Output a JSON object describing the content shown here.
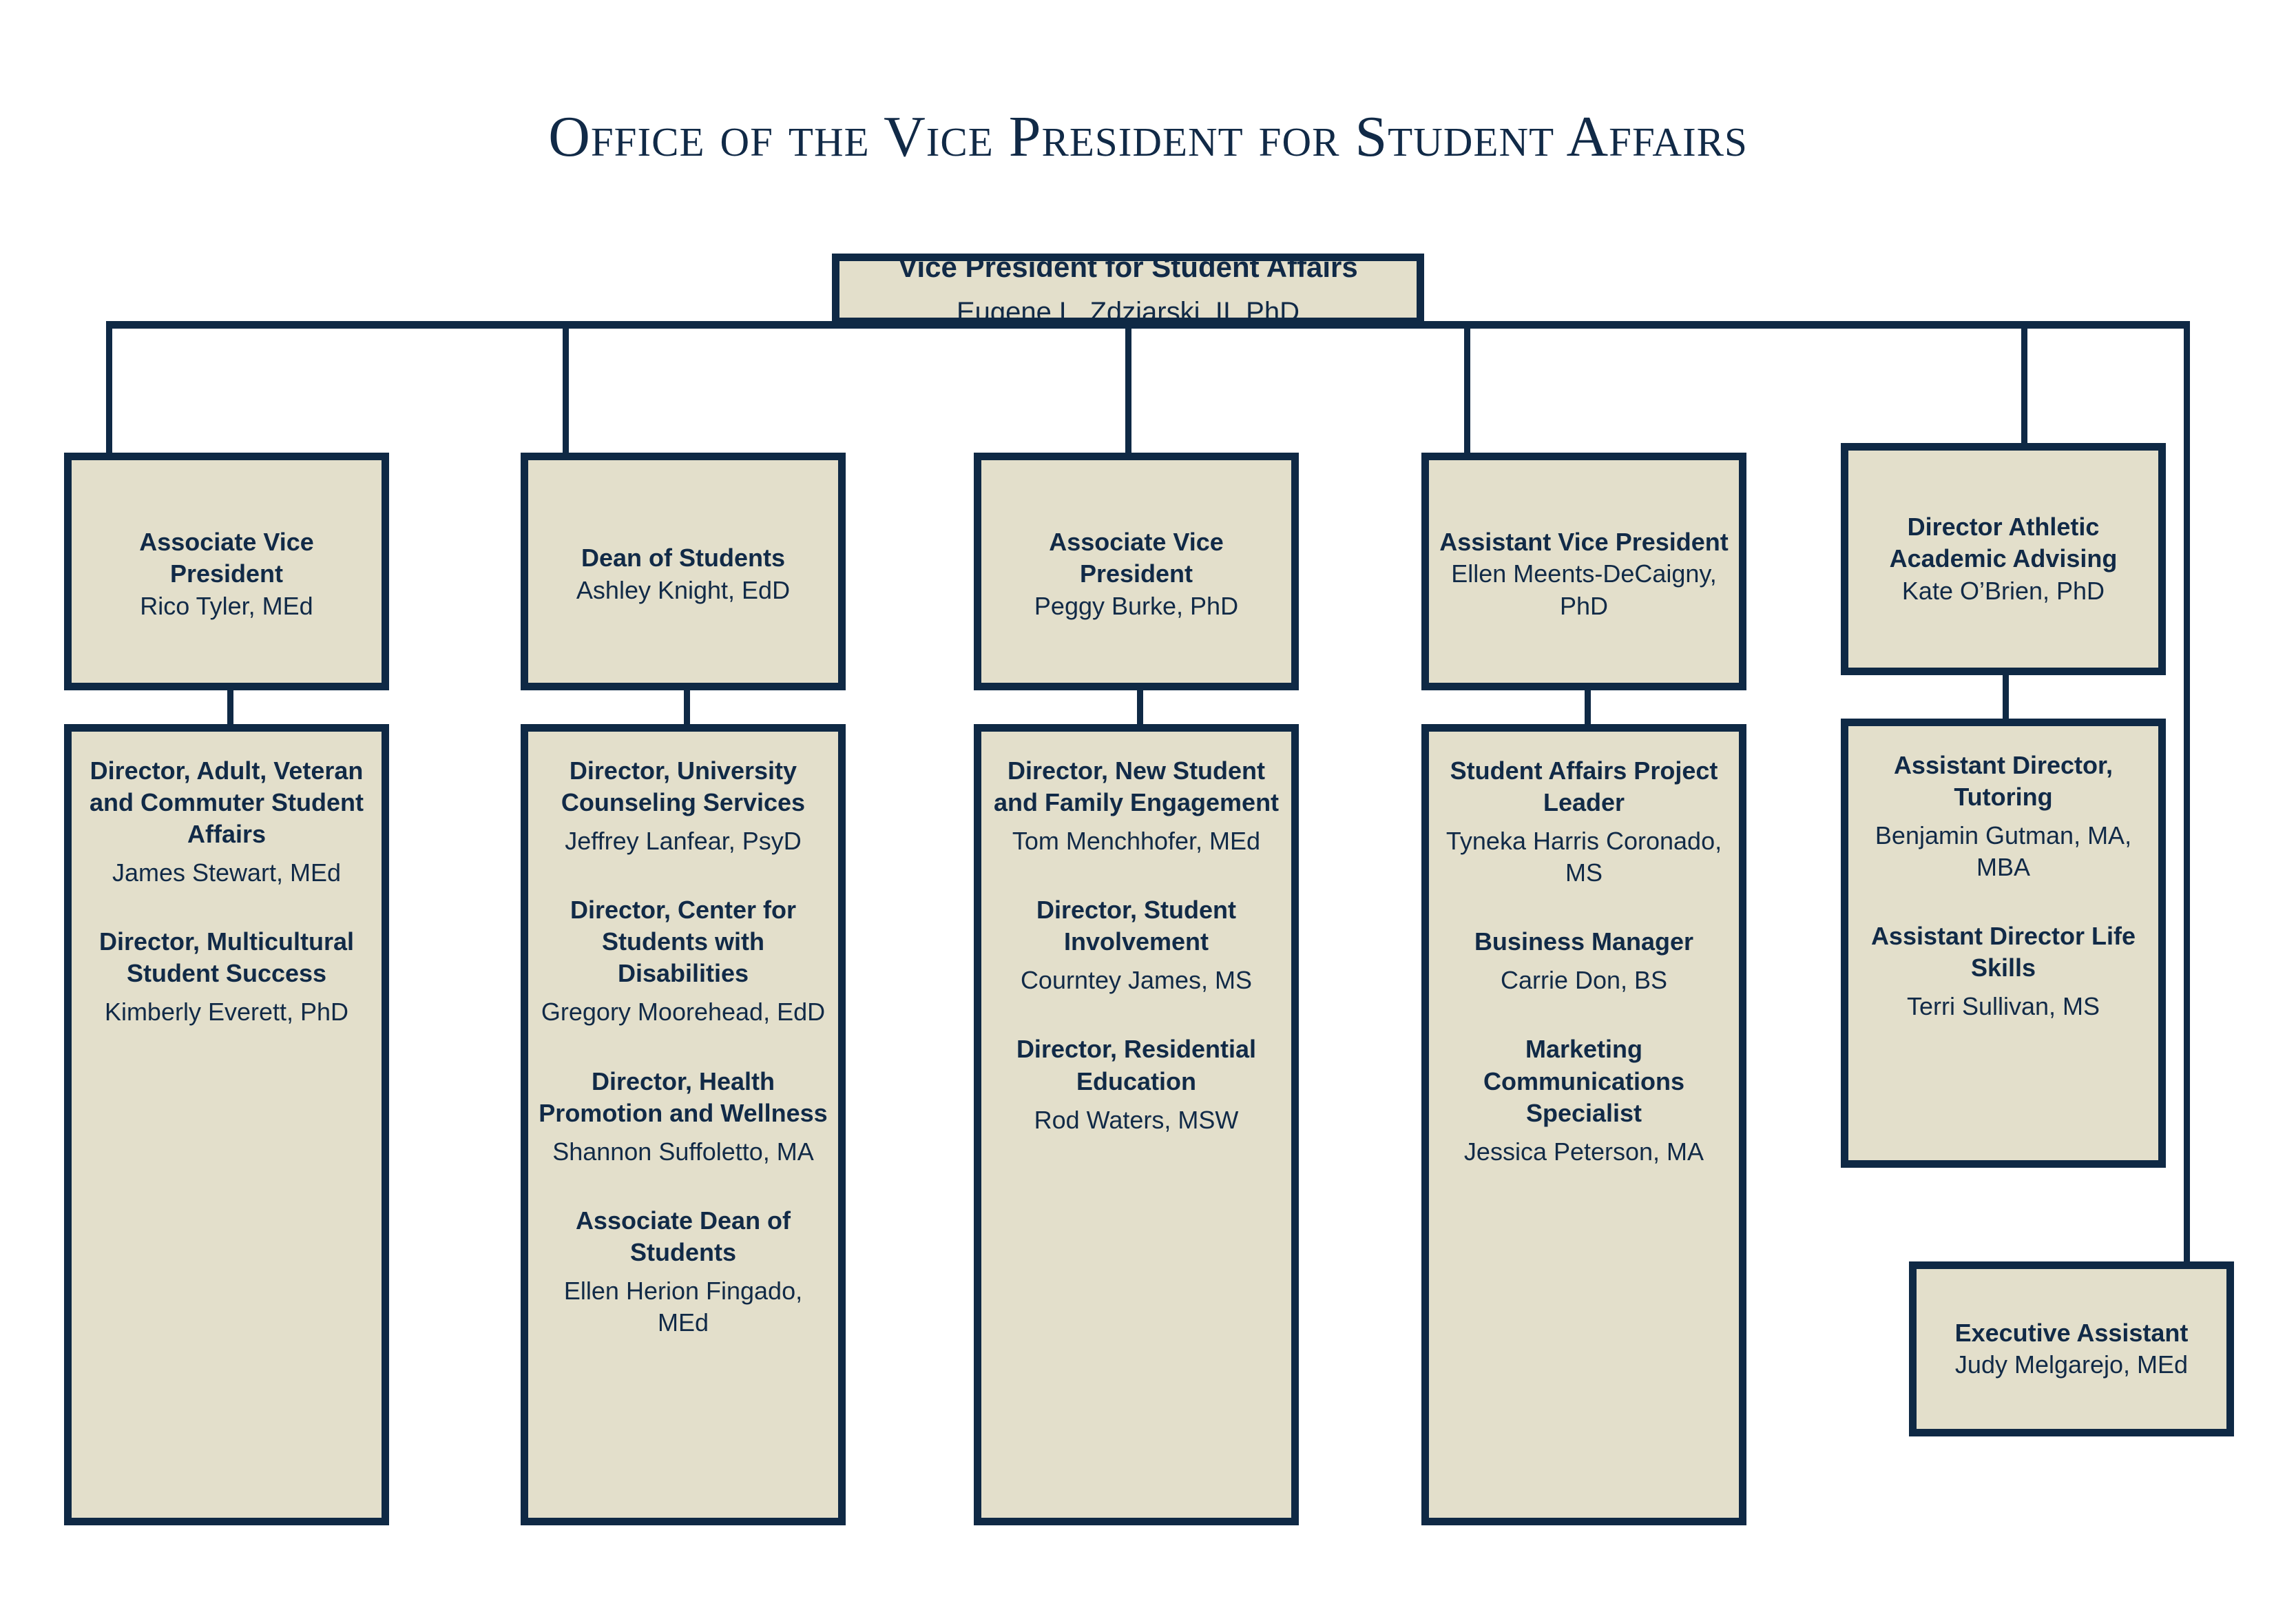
{
  "page": {
    "title": "Office of the Vice President for Student Affairs",
    "accent_border_color": "#0f2945",
    "box_fill_color": "#e3dfcb",
    "text_color": "#112a47"
  },
  "root": {
    "title": "Vice President for Student Affairs",
    "person": "Eugene L. Zdziarski, II, PhD"
  },
  "columns": [
    {
      "head": {
        "title": "Associate Vice President",
        "person": "Rico Tyler, MEd"
      },
      "reports": [
        {
          "title": "Director, Adult, Veteran and Commuter Student Affairs",
          "person": "James Stewart, MEd"
        },
        {
          "title": "Director, Multicultural Student Success",
          "person": "Kimberly Everett, PhD"
        }
      ]
    },
    {
      "head": {
        "title": "Dean of Students",
        "person": "Ashley Knight, EdD"
      },
      "reports": [
        {
          "title": "Director, University Counseling Services",
          "person": "Jeffrey Lanfear, PsyD"
        },
        {
          "title": "Director, Center for Students with Disabilities",
          "person": "Gregory Moorehead, EdD"
        },
        {
          "title": "Director, Health Promotion and Wellness",
          "person": "Shannon Suffoletto, MA"
        },
        {
          "title": "Associate Dean of Students",
          "person": "Ellen Herion Fingado, MEd"
        }
      ]
    },
    {
      "head": {
        "title": "Associate Vice President",
        "person": "Peggy Burke, PhD"
      },
      "reports": [
        {
          "title": "Director, New Student and Family Engagement",
          "person": "Tom Menchhofer, MEd"
        },
        {
          "title": "Director, Student Involvement",
          "person": "Courntey James, MS"
        },
        {
          "title": "Director, Residential Education",
          "person": "Rod Waters, MSW"
        }
      ]
    },
    {
      "head": {
        "title": "Assistant Vice President",
        "person": "Ellen Meents-DeCaigny, PhD"
      },
      "reports": [
        {
          "title": "Student Affairs Project Leader",
          "person": "Tyneka Harris Coronado, MS"
        },
        {
          "title": "Business Manager",
          "person": "Carrie Don, BS"
        },
        {
          "title": "Marketing Communications Specialist",
          "person": "Jessica Peterson, MA"
        }
      ]
    },
    {
      "head": {
        "title": "Director Athletic Academic Advising",
        "person": "Kate O’Brien, PhD"
      },
      "reports": [
        {
          "title": "Assistant Director, Tutoring",
          "person": "Benjamin Gutman, MA, MBA"
        },
        {
          "title": "Assistant Director Life Skills",
          "person": "Terri Sullivan, MS"
        }
      ]
    }
  ],
  "staff": {
    "title": "Executive Assistant",
    "person": "Judy Melgarejo, MEd"
  }
}
